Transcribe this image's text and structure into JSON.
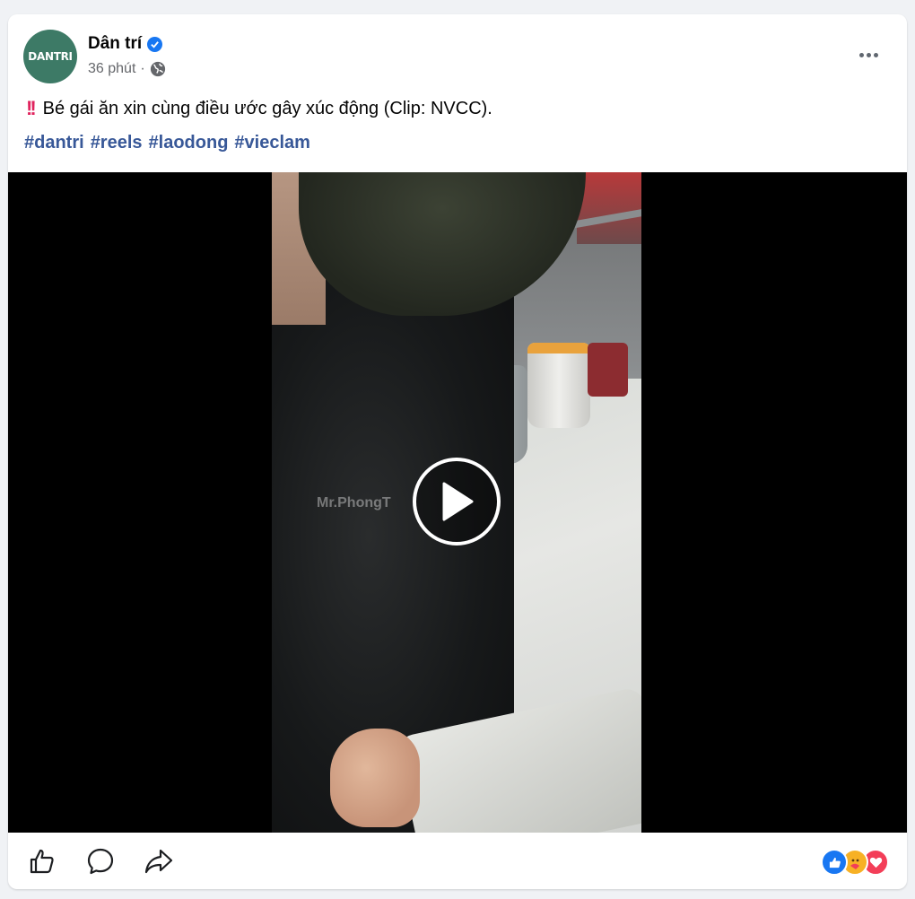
{
  "post": {
    "page_name": "Dân trí",
    "avatar_text": "DANTRI",
    "time": "36 phút",
    "separator": "·",
    "text": "Bé gái ăn xin cùng điều ước gây xúc động (Clip: NVCC).",
    "emoji": "‼️",
    "hashtags": [
      "#dantri",
      "#reels",
      "#laodong",
      "#vieclam"
    ]
  },
  "video": {
    "watermark": "Mr.PhongT"
  },
  "icons": {
    "verified": "verified-badge-icon",
    "privacy": "globe-icon",
    "more": "more-options-icon",
    "play": "play-icon",
    "like": "thumbs-up-icon",
    "comment": "comment-icon",
    "share": "share-icon"
  },
  "reactions": [
    "like",
    "care",
    "love"
  ],
  "colors": {
    "brand_blue": "#1877f2",
    "hashtag": "#385898",
    "avatar_bg": "#3d7a66",
    "love": "#f33e58",
    "care": "#f7b125"
  }
}
